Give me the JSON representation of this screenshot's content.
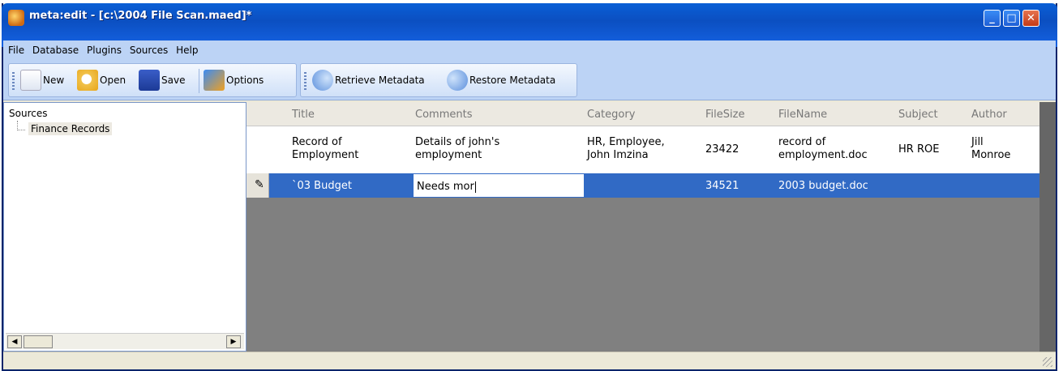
{
  "window": {
    "title": "meta:edit  -  [c:\\2004 File Scan.maed]*",
    "minimize_glyph": "_",
    "maximize_glyph": "□",
    "close_glyph": "✕"
  },
  "menu": {
    "items": [
      "File",
      "Database",
      "Plugins",
      "Sources",
      "Help"
    ]
  },
  "toolbar": {
    "new_label": "New",
    "open_label": "Open",
    "save_label": "Save",
    "options_label": "Options",
    "retrieve_label": "Retrieve Metadata",
    "restore_label": "Restore Metadata"
  },
  "sidebar": {
    "root": "Sources",
    "node": "Finance Records",
    "scroll_left": "◀",
    "scroll_right": "▶"
  },
  "grid": {
    "columns": [
      "Title",
      "Comments",
      "Category",
      "FileSize",
      "FileName",
      "Subject",
      "Author"
    ],
    "rows": [
      {
        "title": [
          "Record of",
          "Employment"
        ],
        "comments": [
          "Details of john's",
          "employment"
        ],
        "category": [
          "HR, Employee,",
          "John Imzina"
        ],
        "filesize": "23422",
        "filename": [
          "record of",
          "employment.doc"
        ],
        "subject": "HR ROE",
        "author": [
          "Jill",
          "Monroe"
        ]
      },
      {
        "title": "`03 Budget",
        "comments_editing": "Needs mor",
        "category": "",
        "filesize": "34521",
        "filename": "2003 budget.doc",
        "subject": "",
        "author": ""
      }
    ],
    "edit_indicator_icon": "pencil-icon"
  },
  "colors": {
    "titlebar": "#0b4fc1",
    "menubar": "#bcd3f5",
    "selection": "#316ac5",
    "grid_background": "#808080"
  }
}
